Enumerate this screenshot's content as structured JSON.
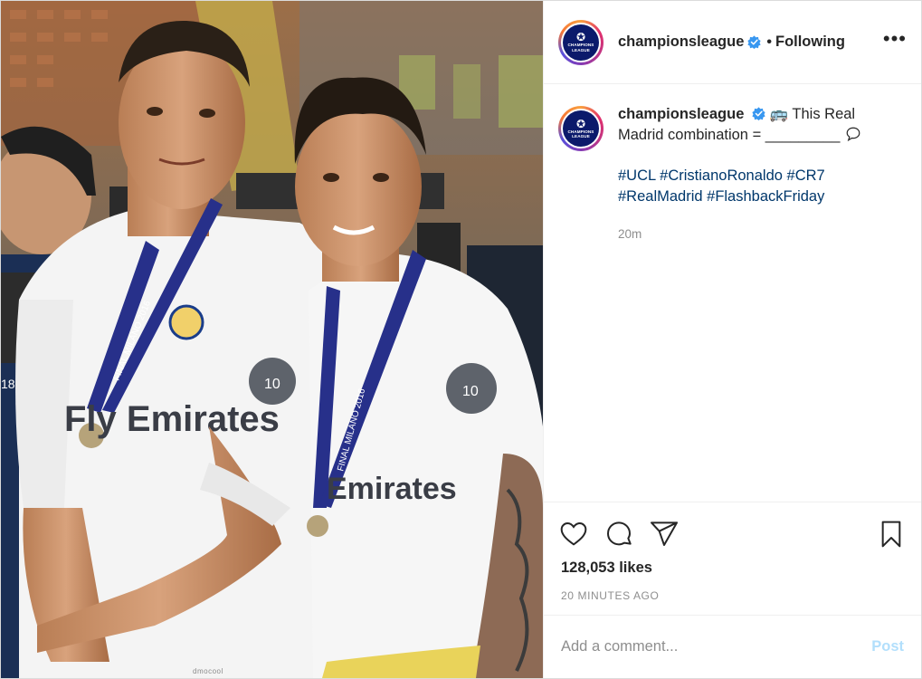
{
  "post": {
    "image_alt": "Two footballers wearing white kits and medals",
    "photo_texts": {
      "shirt_sponsor_left": "Fly Emirates",
      "shirt_sponsor_right": "Emirates",
      "lanyard_left": "FINAL MILANO 2016",
      "lanyard_right": "FINAL MILANO 2016",
      "badge_number": "10",
      "player_number": "18",
      "watermark": "dmocool"
    }
  },
  "header": {
    "username": "championsleague",
    "separator": "•",
    "follow_status": "Following",
    "more_label": "•••",
    "avatar_text": "CHAMPIONS LEAGUE"
  },
  "caption": {
    "username": "championsleague",
    "emoji": "🚌",
    "text": "This Real Madrid combination = _________",
    "speech_icon": "speech-bubble-icon",
    "hashtags": [
      "#UCL",
      "#CristianoRonaldo",
      "#CR7",
      "#RealMadrid",
      "#FlashbackFriday"
    ],
    "time": "20m"
  },
  "actions": {
    "icons": [
      "heart-icon",
      "comment-icon",
      "share-icon",
      "bookmark-icon"
    ]
  },
  "likes": "128,053 likes",
  "timestamp": "20 MINUTES AGO",
  "comment_box": {
    "placeholder": "Add a comment...",
    "post_label": "Post"
  },
  "colors": {
    "verified": "#3897f0",
    "link": "#00376b",
    "post_disabled": "#b2dffc",
    "muted": "#8e8e8e",
    "ucl_blue": "#0b1a6b"
  }
}
